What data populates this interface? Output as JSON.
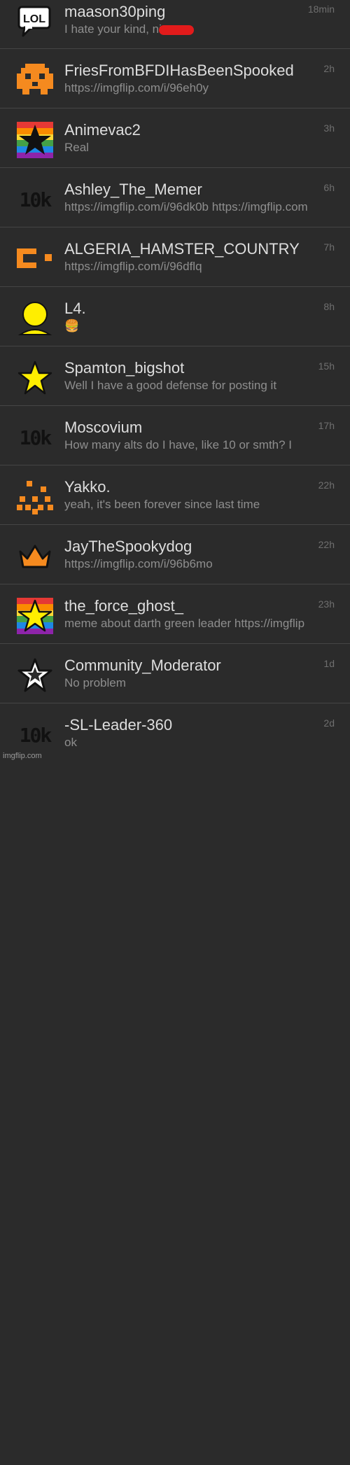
{
  "conversations": [
    {
      "avatar": "lol-bubble-icon",
      "name": "maason30ping",
      "message": "I hate your kind, ni",
      "time": "18min"
    },
    {
      "avatar": "orange-pixel-ghost-icon",
      "name": "FriesFromBFDIHasBeenSpooked",
      "message": "https://imgflip.com/i/96eh0y",
      "time": "2h"
    },
    {
      "avatar": "rainbow-black-star-icon",
      "name": "Animevac2",
      "message": "Real",
      "time": "3h"
    },
    {
      "avatar": "10k-icon",
      "avatar_text": "10k",
      "name": "Ashley_The_Memer",
      "message": "https://imgflip.com/i/96dk0b https://imgflip.com",
      "time": "6h"
    },
    {
      "avatar": "orange-pixel-c-icon",
      "name": "ALGERIA_HAMSTER_COUNTRY",
      "message": "https://imgflip.com/i/96dflq",
      "time": "7h"
    },
    {
      "avatar": "yellow-person-icon",
      "name": "L4.",
      "message": "🍔",
      "time": "8h"
    },
    {
      "avatar": "yellow-star-icon",
      "name": "Spamton_bigshot",
      "message": "Well I have a good defense for posting it",
      "time": "15h"
    },
    {
      "avatar": "10k-icon",
      "avatar_text": "10k",
      "name": "Moscovium",
      "message": "How many alts do I have, like 10 or smth? I",
      "time": "17h"
    },
    {
      "avatar": "orange-pixel-pattern-icon",
      "name": "Yakko.",
      "message": "yeah, it's been forever since last time",
      "time": "22h"
    },
    {
      "avatar": "orange-crown-icon",
      "name": "JayTheSpookydog",
      "message": "https://imgflip.com/i/96b6mo",
      "time": "22h"
    },
    {
      "avatar": "rainbow-yellow-star-icon",
      "name": "the_force_ghost_",
      "message": "meme about darth green leader https://imgflip",
      "time": "23h"
    },
    {
      "avatar": "outline-star-icon",
      "name": "Community_Moderator",
      "message": "No problem",
      "time": "1d"
    },
    {
      "avatar": "10k-icon",
      "avatar_text": "10k",
      "name": "-SL-Leader-360",
      "message": "ok",
      "time": "2d"
    }
  ],
  "watermark": "imgflip.com",
  "colors": {
    "background": "#2b2b2b",
    "divider": "#454545",
    "name": "#dedede",
    "message": "#8e8e8e",
    "time": "#6f6f6f",
    "orange": "#f58a1f",
    "yellow": "#ffee00",
    "censor": "#e21b1b"
  }
}
